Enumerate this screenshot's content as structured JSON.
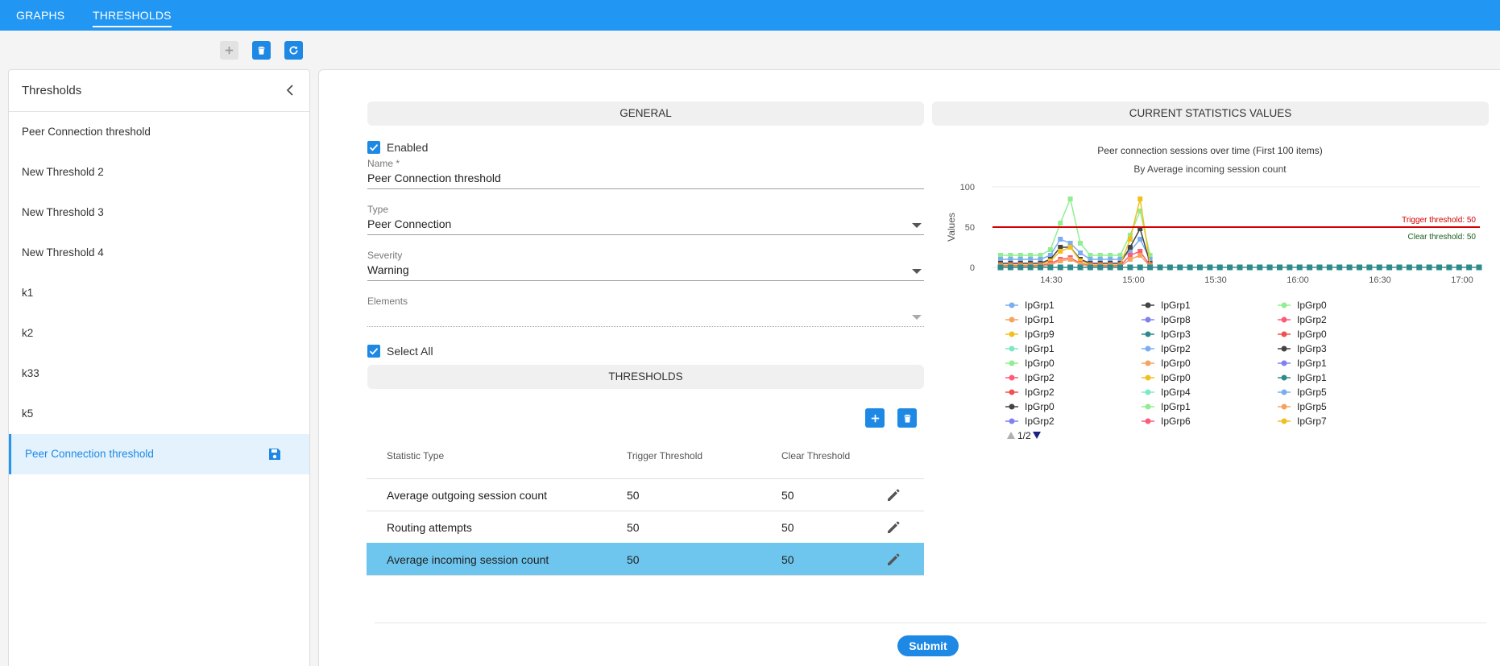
{
  "nav": {
    "tabs": [
      {
        "label": "GRAPHS"
      },
      {
        "label": "THRESHOLDS"
      }
    ]
  },
  "sidebar": {
    "title": "Thresholds",
    "items": [
      {
        "label": "Peer Connection threshold"
      },
      {
        "label": "New Threshold 2"
      },
      {
        "label": "New Threshold 3"
      },
      {
        "label": "New Threshold 4"
      },
      {
        "label": "k1"
      },
      {
        "label": "k2"
      },
      {
        "label": "k33"
      },
      {
        "label": "k5"
      },
      {
        "label": "Peer Connection threshold"
      }
    ]
  },
  "general": {
    "header": "GENERAL",
    "enabled_label": "Enabled",
    "name_label": "Name *",
    "name_value": "Peer Connection threshold",
    "type_label": "Type",
    "type_value": "Peer Connection",
    "severity_label": "Severity",
    "severity_value": "Warning",
    "elements_label": "Elements",
    "select_all_label": "Select All"
  },
  "thresholds": {
    "header": "THRESHOLDS",
    "columns": [
      "Statistic Type",
      "Trigger Threshold",
      "Clear Threshold"
    ],
    "rows": [
      {
        "type": "Average outgoing session count",
        "trigger": "50",
        "clear": "50"
      },
      {
        "type": "Routing attempts",
        "trigger": "50",
        "clear": "50"
      },
      {
        "type": "Average incoming session count",
        "trigger": "50",
        "clear": "50"
      }
    ]
  },
  "stats": {
    "header": "CURRENT STATISTICS VALUES"
  },
  "submit_label": "Submit",
  "colors": {
    "primary": "#1e88e5",
    "topbar": "#2196f3",
    "selected_row": "#6ec6ee",
    "trigger": "#d50000",
    "clear": "#1b5e20"
  },
  "chart_data": {
    "type": "line",
    "title": "Peer connection sessions over time (First 100 items)",
    "subtitle": "By Average incoming session count",
    "ylabel": "Values",
    "ylim": [
      0,
      100
    ],
    "yticks": [
      "0",
      "50",
      "100"
    ],
    "xticks": [
      "14:30",
      "15:00",
      "15:30",
      "16:00",
      "16:30",
      "17:00"
    ],
    "trigger_label": "Trigger threshold: 50",
    "clear_label": "Clear threshold: 50",
    "trigger_value": 50,
    "clear_value": 50,
    "legend_page": "1/2",
    "legend_columns": [
      [
        "IpGrp1",
        "IpGrp1",
        "IpGrp9",
        "IpGrp1",
        "IpGrp0",
        "IpGrp2",
        "IpGrp2",
        "IpGrp0",
        "IpGrp2"
      ],
      [
        "IpGrp1",
        "IpGrp8",
        "IpGrp3",
        "IpGrp2",
        "IpGrp0",
        "IpGrp0",
        "IpGrp4",
        "IpGrp1",
        "IpGrp6"
      ],
      [
        "IpGrp0",
        "IpGrp2",
        "IpGrp0",
        "IpGrp3",
        "IpGrp1",
        "IpGrp1",
        "IpGrp5",
        "IpGrp5",
        "IpGrp7"
      ]
    ],
    "series": [
      {
        "color": "#90ee90",
        "values": [
          15,
          15,
          15,
          15,
          15,
          22,
          55,
          85,
          30,
          15,
          15,
          15,
          15,
          40,
          70,
          15
        ]
      },
      {
        "color": "#7aaef0",
        "values": [
          10,
          10,
          10,
          10,
          10,
          15,
          35,
          30,
          18,
          10,
          10,
          10,
          10,
          20,
          35,
          10
        ]
      },
      {
        "color": "#444444",
        "values": [
          5,
          5,
          5,
          5,
          5,
          10,
          25,
          25,
          10,
          5,
          5,
          5,
          5,
          25,
          48,
          5
        ]
      },
      {
        "color": "#f0c020",
        "values": [
          3,
          3,
          3,
          3,
          3,
          8,
          20,
          25,
          8,
          3,
          3,
          3,
          3,
          35,
          85,
          3
        ]
      },
      {
        "color": "#ff5a78",
        "values": [
          2,
          2,
          2,
          2,
          2,
          5,
          10,
          12,
          5,
          2,
          2,
          2,
          2,
          15,
          20,
          2
        ]
      },
      {
        "color": "#f4a460",
        "values": [
          1,
          1,
          1,
          1,
          1,
          3,
          8,
          10,
          4,
          1,
          1,
          1,
          1,
          10,
          15,
          1
        ]
      },
      {
        "color": "#2e8b8b",
        "values": [
          0,
          0,
          0,
          0,
          0,
          0,
          0,
          0,
          0,
          0,
          0,
          0,
          0,
          0,
          0,
          0,
          0,
          0,
          0,
          0,
          0,
          0,
          0,
          0,
          0,
          0,
          0,
          0,
          0,
          0,
          0,
          0,
          0,
          0,
          0,
          0,
          0,
          0,
          0,
          0,
          0,
          0,
          0,
          0,
          0,
          0,
          0,
          0,
          0
        ]
      }
    ]
  }
}
